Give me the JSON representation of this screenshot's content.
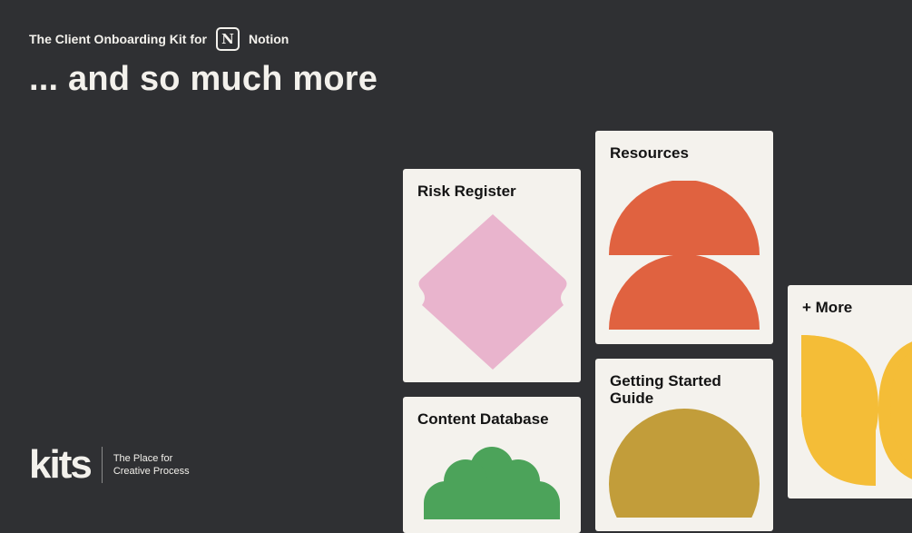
{
  "header": {
    "kicker_prefix": "The Client Onboarding Kit for",
    "notion_logo_letter": "N",
    "kicker_brand": "Notion",
    "headline": "... and so much more"
  },
  "cards": {
    "risk_register": {
      "title": "Risk Register",
      "shape_color": "#e9b4cd"
    },
    "resources": {
      "title": "Resources",
      "shape_color": "#e06240"
    },
    "more": {
      "title": "+ More",
      "shape_color": "#f4bd37"
    },
    "getting_started": {
      "title": "Getting Started Guide",
      "shape_color": "#c29d3a"
    },
    "content_database": {
      "title": "Content Database",
      "shape_color": "#4ca35a"
    }
  },
  "footer": {
    "logo_text": "kits",
    "tagline_line1": "The Place for",
    "tagline_line2": "Creative Process"
  },
  "colors": {
    "background": "#2f3033",
    "card": "#f4f2ed",
    "text_light": "#f3f1ec"
  }
}
